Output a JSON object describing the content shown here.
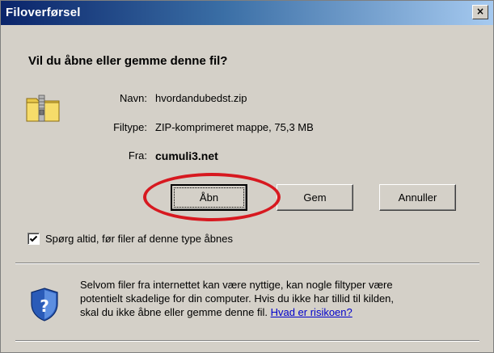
{
  "window": {
    "title": "Filoverførsel",
    "close_glyph": "×"
  },
  "question": "Vil du åbne eller gemme denne fil?",
  "file": {
    "name_label": "Navn:",
    "name_value": "hvordandubedst.zip",
    "type_label": "Filtype:",
    "type_value": "ZIP-komprimeret mappe, 75,3 MB",
    "from_label": "Fra:",
    "from_value": "cumuli3.net",
    "icon": "zip-folder-icon"
  },
  "buttons": {
    "open": "Åbn",
    "save": "Gem",
    "cancel": "Annuller"
  },
  "checkbox": {
    "label": "Spørg altid, før filer af denne type åbnes",
    "checked": true
  },
  "info": {
    "line1": "Selvom filer fra internettet kan være nyttige, kan nogle filtyper være",
    "line2": "potentielt skadelige for din computer. Hvis du ikke har tillid til kilden,",
    "line3": "skal du ikke åbne eller gemme denne fil.",
    "link": "Hvad er risikoen?",
    "icon": "shield-question-icon"
  },
  "colors": {
    "highlight": "#d71920",
    "titlebar_start": "#0a246a",
    "titlebar_end": "#a6caf0",
    "link": "#0000cc"
  }
}
